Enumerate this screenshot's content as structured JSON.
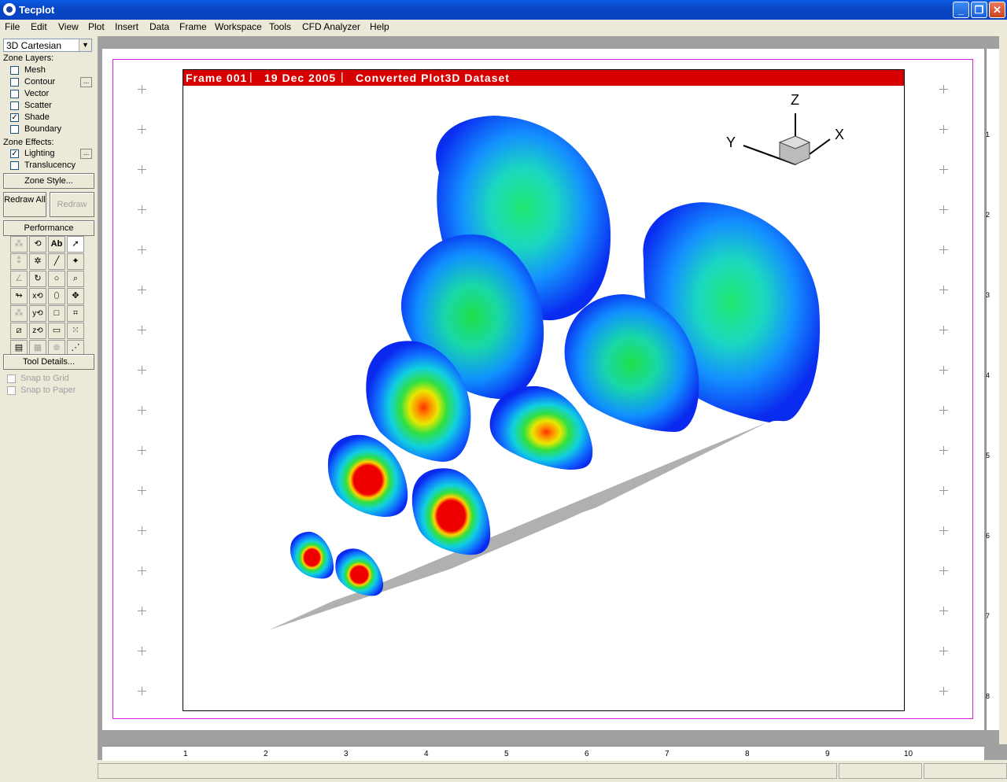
{
  "window": {
    "title": "Tecplot"
  },
  "menu": [
    "File",
    "Edit",
    "View",
    "Plot",
    "Insert",
    "Data",
    "Frame",
    "Workspace",
    "Tools",
    "CFD Analyzer",
    "Help"
  ],
  "sidebar": {
    "plot_type": "3D Cartesian",
    "zone_layers_label": "Zone Layers:",
    "layers": [
      {
        "label": "Mesh",
        "checked": false
      },
      {
        "label": "Contour",
        "checked": false
      },
      {
        "label": "Vector",
        "checked": false
      },
      {
        "label": "Scatter",
        "checked": false
      },
      {
        "label": "Shade",
        "checked": true
      },
      {
        "label": "Boundary",
        "checked": false
      }
    ],
    "zone_effects_label": "Zone Effects:",
    "effects": [
      {
        "label": "Lighting",
        "checked": true
      },
      {
        "label": "Translucency",
        "checked": false
      }
    ],
    "zone_style_button": "Zone Style...",
    "redraw_all_button": "Redraw All",
    "redraw_button": "Redraw",
    "performance_button": "Performance",
    "tool_details_button": "Tool Details...",
    "snap_grid": "Snap to Grid",
    "snap_paper": "Snap to Paper"
  },
  "frame": {
    "name": "Frame 001",
    "date": "19 Dec 2005",
    "dataset": "Converted Plot3D Dataset"
  },
  "axes": {
    "x": "X",
    "y": "Y",
    "z": "Z"
  },
  "ruler": {
    "horizontal": [
      "1",
      "2",
      "3",
      "4",
      "5",
      "6",
      "7",
      "8",
      "9",
      "10"
    ],
    "vertical": [
      "1",
      "2",
      "3",
      "4",
      "5",
      "6",
      "7",
      "8"
    ]
  },
  "colors": {
    "frame_header": "#d60000",
    "surface": "#b0b0b0",
    "margin": "#e020e0"
  }
}
